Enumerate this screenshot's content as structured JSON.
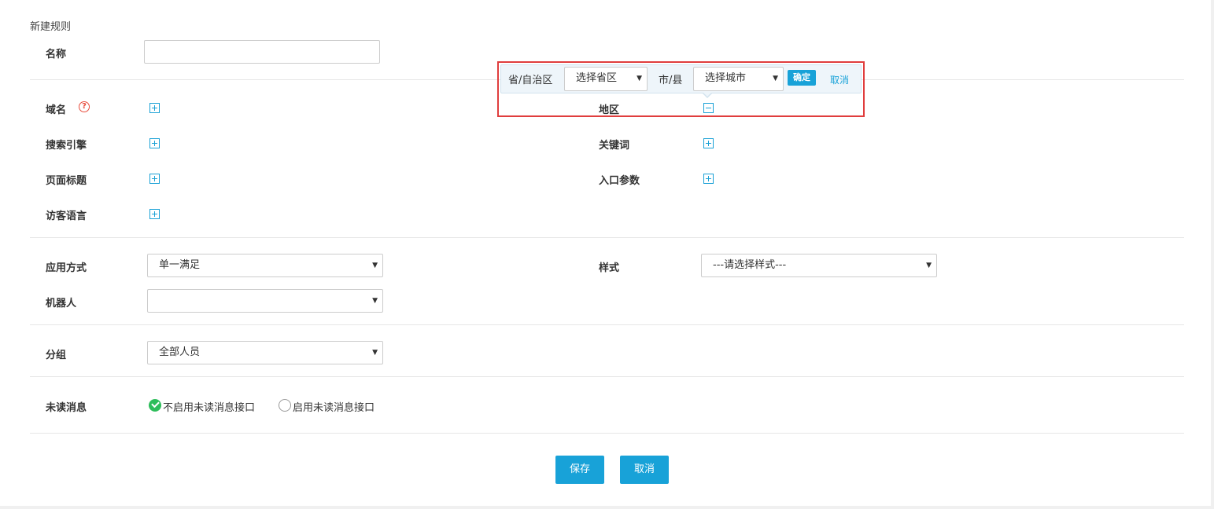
{
  "form": {
    "section_title": "新建规则",
    "name_label": "名称",
    "name_value": "",
    "domain_label": "域名",
    "help_glyph": "?",
    "search_engine_label": "搜索引擎",
    "page_title_label": "页面标题",
    "visitor_language_label": "访客语言",
    "region_label": "地区",
    "keyword_label": "关键词",
    "entry_param_label": "入口参数",
    "apply_mode_label": "应用方式",
    "apply_mode_value": "单一满足",
    "style_label": "样式",
    "style_value": "---请选择样式---",
    "robot_label": "机器人",
    "robot_value": "",
    "group_label": "分组",
    "group_value": "全部人员",
    "unread_label": "未读消息",
    "unread_option_off": "不启用未读消息接口",
    "unread_option_on": "启用未读消息接口",
    "save_label": "保存",
    "cancel_label": "取消"
  },
  "region_popup": {
    "province_label": "省/自治区",
    "province_value": "选择省区",
    "city_label": "市/县",
    "city_value": "选择城市",
    "confirm_label": "确定",
    "cancel_label": "取消"
  },
  "colors": {
    "accent": "#18a2d8",
    "highlight_border": "#e03d3d",
    "radio_checked": "#2dbd5a"
  }
}
